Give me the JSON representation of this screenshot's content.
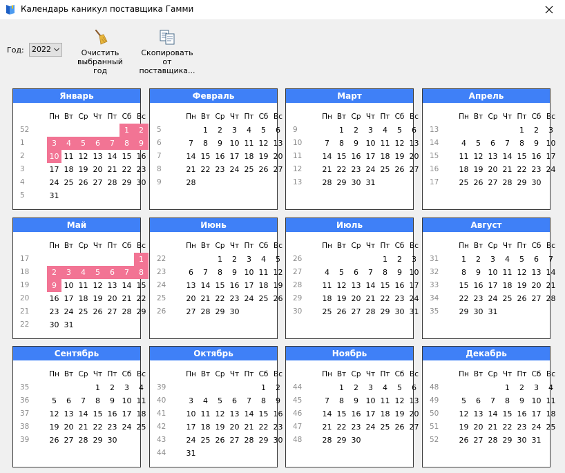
{
  "window": {
    "title": "Календарь каникул поставщика Гамми",
    "close_icon": "close-icon"
  },
  "toolbar": {
    "year_label": "Год:",
    "year_value": "2022",
    "clear_label_1": "Очистить",
    "clear_label_2": "выбранный год",
    "copy_label_1": "Скопировать",
    "copy_label_2": "от поставщика..."
  },
  "colors": {
    "header": "#3f80f7",
    "holiday": "#f27494"
  },
  "weekday_labels": [
    "Пн",
    "Вт",
    "Ср",
    "Чт",
    "Пт",
    "Сб",
    "Вс"
  ],
  "months": [
    {
      "name": "Январь",
      "first_dow": 5,
      "days": 31,
      "weeks": [
        "52",
        "1",
        "2",
        "3",
        "4",
        "5"
      ],
      "holidays": [
        1,
        2,
        3,
        4,
        5,
        6,
        7,
        8,
        9,
        10
      ]
    },
    {
      "name": "Февраль",
      "first_dow": 1,
      "days": 28,
      "weeks": [
        "5",
        "6",
        "7",
        "8",
        "9"
      ],
      "holidays": []
    },
    {
      "name": "Март",
      "first_dow": 1,
      "days": 31,
      "weeks": [
        "9",
        "10",
        "11",
        "12",
        "13"
      ],
      "holidays": []
    },
    {
      "name": "Апрель",
      "first_dow": 4,
      "days": 30,
      "weeks": [
        "13",
        "14",
        "15",
        "16",
        "17"
      ],
      "holidays": []
    },
    {
      "name": "Май",
      "first_dow": 6,
      "days": 31,
      "weeks": [
        "17",
        "18",
        "19",
        "20",
        "21",
        "22"
      ],
      "holidays": [
        1,
        2,
        3,
        4,
        5,
        6,
        7,
        8,
        9
      ]
    },
    {
      "name": "Июнь",
      "first_dow": 2,
      "days": 30,
      "weeks": [
        "22",
        "23",
        "24",
        "25",
        "26"
      ],
      "holidays": []
    },
    {
      "name": "Июль",
      "first_dow": 4,
      "days": 31,
      "weeks": [
        "26",
        "27",
        "28",
        "29",
        "30"
      ],
      "holidays": []
    },
    {
      "name": "Август",
      "first_dow": 0,
      "days": 31,
      "weeks": [
        "31",
        "32",
        "33",
        "34",
        "35"
      ],
      "holidays": []
    },
    {
      "name": "Сентябрь",
      "first_dow": 3,
      "days": 30,
      "weeks": [
        "35",
        "36",
        "37",
        "38",
        "39"
      ],
      "holidays": []
    },
    {
      "name": "Октябрь",
      "first_dow": 5,
      "days": 31,
      "weeks": [
        "39",
        "40",
        "41",
        "42",
        "43",
        "44"
      ],
      "holidays": []
    },
    {
      "name": "Ноябрь",
      "first_dow": 1,
      "days": 30,
      "weeks": [
        "44",
        "45",
        "46",
        "47",
        "48"
      ],
      "holidays": []
    },
    {
      "name": "Декабрь",
      "first_dow": 3,
      "days": 31,
      "weeks": [
        "48",
        "49",
        "50",
        "51",
        "52"
      ],
      "holidays": []
    }
  ]
}
